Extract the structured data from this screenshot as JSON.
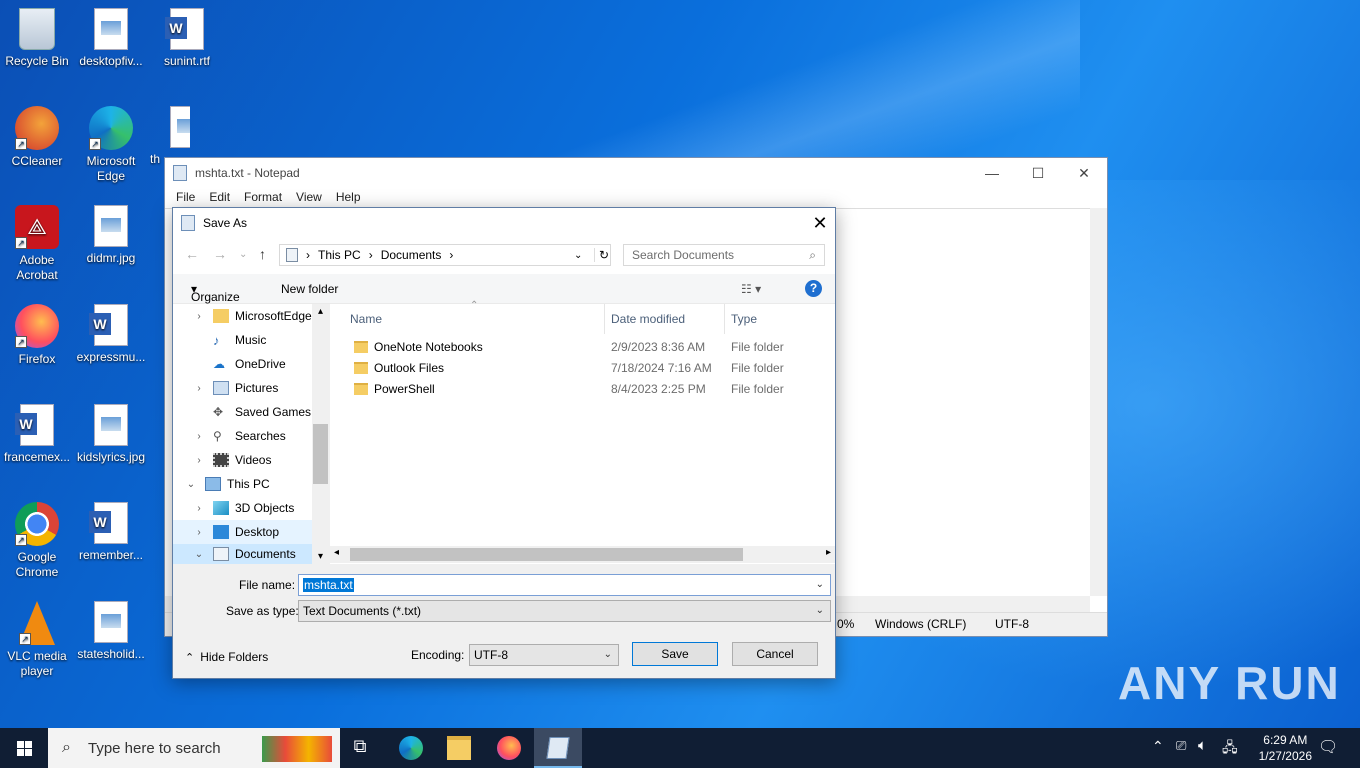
{
  "desktop": {
    "icons": [
      {
        "label": "Recycle Bin"
      },
      {
        "label": "desktopfiv..."
      },
      {
        "label": "sunint.rtf"
      },
      {
        "label": "CCleaner"
      },
      {
        "label": "Microsoft Edge"
      },
      {
        "label": "th"
      },
      {
        "label": "Adobe Acrobat"
      },
      {
        "label": "didmr.jpg"
      },
      {
        "label": "Firefox"
      },
      {
        "label": "expressmu..."
      },
      {
        "label": "francemex..."
      },
      {
        "label": "kidslyrics.jpg"
      },
      {
        "label": "Google Chrome"
      },
      {
        "label": "remember..."
      },
      {
        "label": "VLC media player"
      },
      {
        "label": "statesholid..."
      }
    ],
    "watermark": "ANY RUN"
  },
  "notepad": {
    "title": "mshta.txt - Notepad",
    "menu": [
      "File",
      "Edit",
      "Format",
      "View",
      "Help"
    ],
    "status": {
      "zoom": "0%",
      "line_ending": "Windows (CRLF)",
      "encoding": "UTF-8"
    }
  },
  "dialog": {
    "title": "Save As",
    "breadcrumb": [
      "This PC",
      "Documents"
    ],
    "search_placeholder": "Search Documents",
    "organize": "Organize",
    "new_folder": "New folder",
    "tree": [
      {
        "label": "MicrosoftEdge"
      },
      {
        "label": "Music"
      },
      {
        "label": "OneDrive"
      },
      {
        "label": "Pictures"
      },
      {
        "label": "Saved Games"
      },
      {
        "label": "Searches"
      },
      {
        "label": "Videos"
      },
      {
        "label": "This PC"
      },
      {
        "label": "3D Objects"
      },
      {
        "label": "Desktop"
      },
      {
        "label": "Documents"
      }
    ],
    "columns": {
      "name": "Name",
      "date": "Date modified",
      "type": "Type"
    },
    "files": [
      {
        "name": "OneNote Notebooks",
        "date": "2/9/2023 8:36 AM",
        "type": "File folder"
      },
      {
        "name": "Outlook Files",
        "date": "7/18/2024 7:16 AM",
        "type": "File folder"
      },
      {
        "name": "PowerShell",
        "date": "8/4/2023 2:25 PM",
        "type": "File folder"
      }
    ],
    "file_name_label": "File name:",
    "file_name_value": "mshta.txt",
    "save_type_label": "Save as type:",
    "save_type_value": "Text Documents (*.txt)",
    "hide_folders": "Hide Folders",
    "encoding_label": "Encoding:",
    "encoding_value": "UTF-8",
    "save": "Save",
    "cancel": "Cancel"
  },
  "taskbar": {
    "search_placeholder": "Type here to search",
    "time": "6:29 AM",
    "date": "1/27/2026"
  }
}
